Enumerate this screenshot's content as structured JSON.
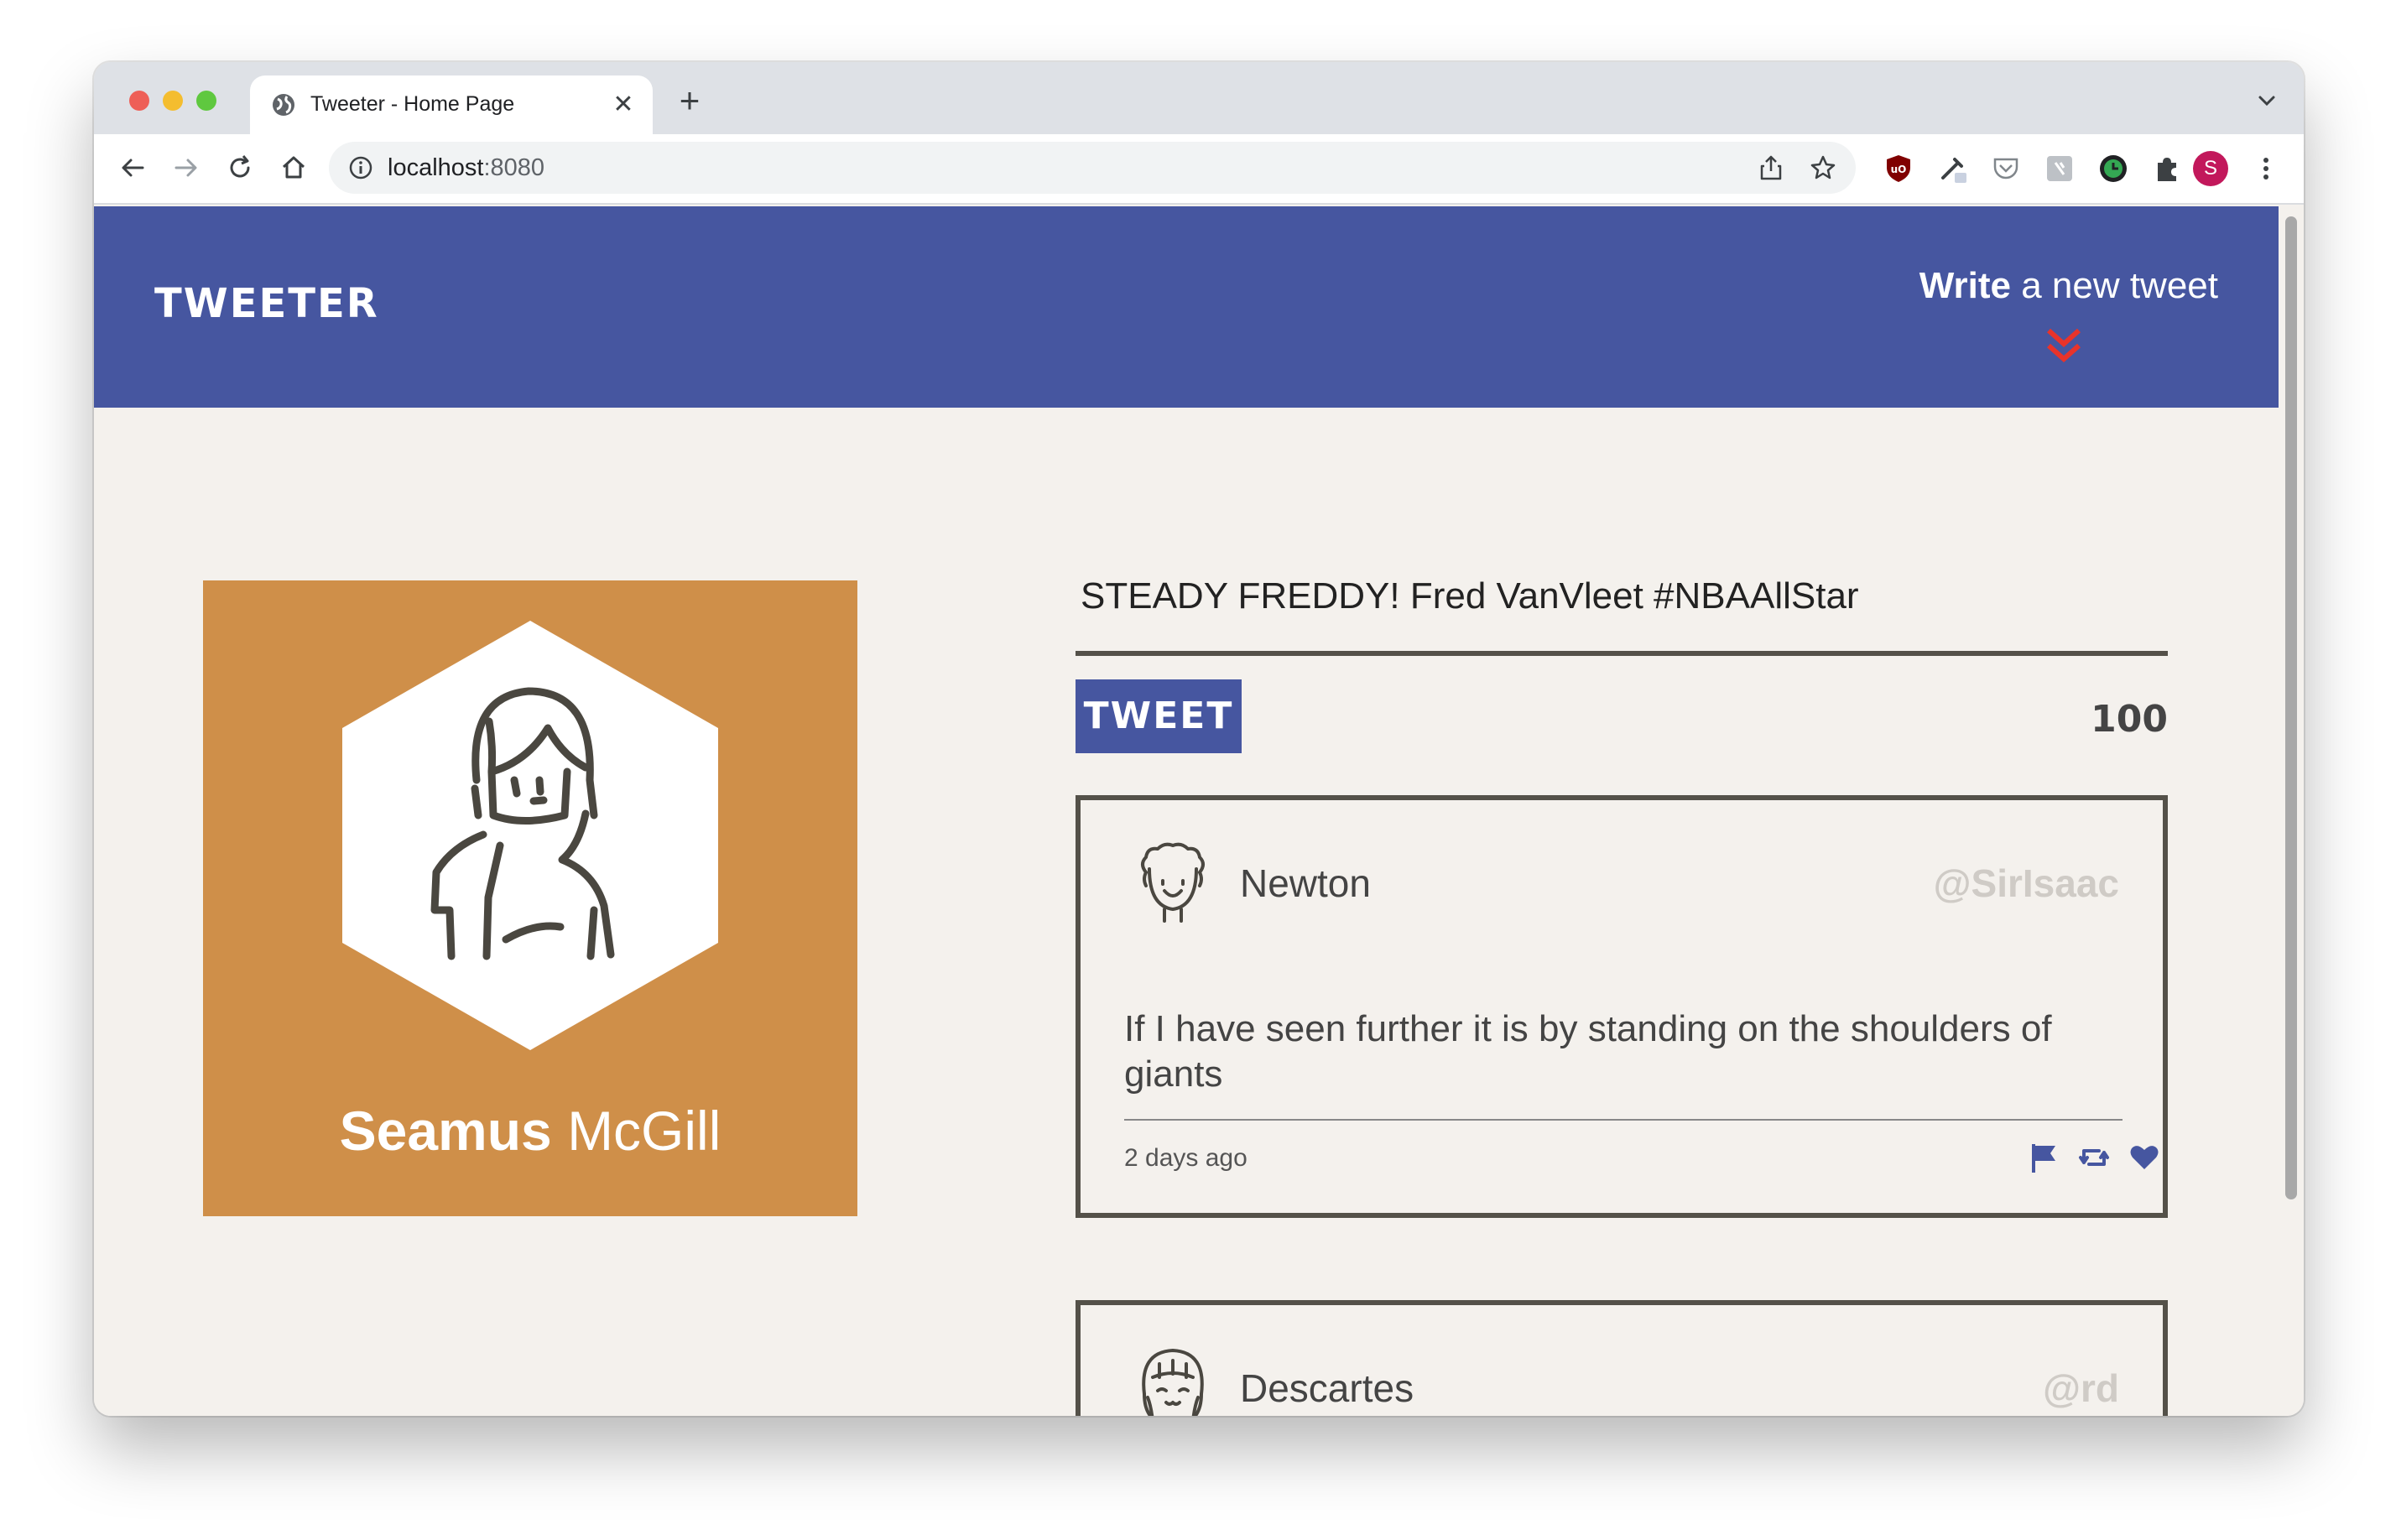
{
  "browser": {
    "tab_title": "Tweeter - Home Page",
    "url_host": "localhost",
    "url_port": ":8080",
    "profile_initial": "S"
  },
  "header": {
    "logo": "TWEETER",
    "compose_bold": "Write",
    "compose_rest": " a new tweet",
    "accent_color": "#e8332a",
    "background_color": "#4656a0"
  },
  "profile": {
    "first_name": "Seamus",
    "last_name": " McGill",
    "card_color": "#cf8f49"
  },
  "compose": {
    "text": "STEADY FREDDY! Fred VanVleet #NBAAllStar",
    "button_label": "TWEET",
    "counter": "100"
  },
  "tweets": [
    {
      "author": "Newton",
      "handle": "@SirIsaac",
      "body": "If I have seen further it is by standing on the shoulders of giants",
      "time": "2 days ago",
      "actions": [
        "flag-icon",
        "retweet-icon",
        "heart-icon"
      ]
    },
    {
      "author": "Descartes",
      "handle": "@rd"
    }
  ]
}
